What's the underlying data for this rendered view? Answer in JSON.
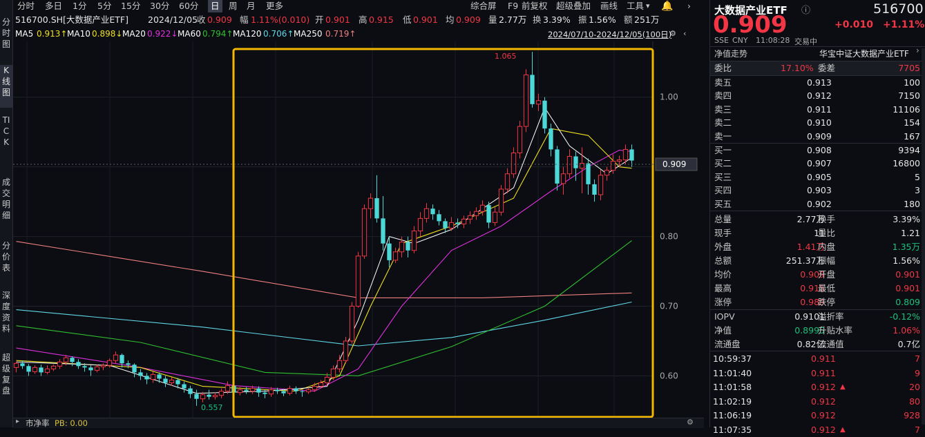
{
  "left_tabs": [
    {
      "label": "分时图"
    },
    {
      "label": "K线图"
    },
    {
      "label": "TICK"
    },
    {
      "label": "成交明细"
    },
    {
      "label": "分价表"
    },
    {
      "label": "深度资料"
    },
    {
      "label": "超级复盘"
    }
  ],
  "toolbar": {
    "periods": [
      "分时",
      "多日",
      "1分",
      "5分",
      "15分",
      "30分",
      "60分",
      "日",
      "周",
      "月",
      "更多"
    ],
    "active_period": "日",
    "right_items": [
      "综合屏",
      "F9",
      "前复权",
      "超级叠加",
      "画线",
      "工具"
    ]
  },
  "info_line": {
    "symbol": "516700.SH[大数据产业ETF]",
    "date": "2024/12/05",
    "close_label": "收",
    "close": "0.909",
    "amp_label": "幅",
    "amp": "1.11%(0.010)",
    "open_label": "开",
    "open": "0.901",
    "high_label": "高",
    "high": "0.915",
    "low_label": "低",
    "low": "0.901",
    "avg_label": "均",
    "avg": "0.909",
    "vol_label": "量",
    "vol": "2.77万",
    "turn_label": "换",
    "turn": "3.39%",
    "swing_label": "振",
    "swing": "1.56%",
    "amount_label": "额",
    "amount": "251万"
  },
  "ma_line": {
    "ma5_label": "MA5",
    "ma5": "0.913↑",
    "ma10_label": "MA10",
    "ma10": "0.898↓",
    "ma20_label": "MA20",
    "ma20": "0.922↓",
    "ma60_label": "MA60",
    "ma60": "0.794↑",
    "ma120_label": "MA120",
    "ma120": "0.706↑",
    "ma250_label": "MA250",
    "ma250": "0.719↑",
    "range": "2024/07/10-2024/12/05(100日)"
  },
  "colors": {
    "ma5": "#ffffff",
    "ma10": "#f0e020",
    "ma20": "#e030e0",
    "ma60": "#30c030",
    "ma120": "#60d8e8",
    "ma250": "#f08080",
    "up": "#f23645",
    "down": "#4dd8d8",
    "highlight": "#f5b800"
  },
  "chart_data": {
    "type": "candlestick",
    "y_ticks": [
      "1.00",
      "0.90",
      "0.80",
      "0.70",
      "0.60"
    ],
    "ylim": [
      0.54,
      1.08
    ],
    "price_tag": "0.909",
    "high_label": "1.065",
    "low_label": "0.557",
    "candles": [
      [
        0.612,
        0.618,
        0.605,
        0.62
      ],
      [
        0.618,
        0.614,
        0.61,
        0.622
      ],
      [
        0.614,
        0.606,
        0.6,
        0.617
      ],
      [
        0.606,
        0.612,
        0.603,
        0.615
      ],
      [
        0.612,
        0.605,
        0.6,
        0.616
      ],
      [
        0.605,
        0.61,
        0.602,
        0.615
      ],
      [
        0.61,
        0.614,
        0.607,
        0.616
      ],
      [
        0.614,
        0.62,
        0.61,
        0.624
      ],
      [
        0.62,
        0.626,
        0.615,
        0.63
      ],
      [
        0.626,
        0.62,
        0.614,
        0.628
      ],
      [
        0.62,
        0.614,
        0.61,
        0.624
      ],
      [
        0.614,
        0.612,
        0.606,
        0.618
      ],
      [
        0.612,
        0.608,
        0.6,
        0.615
      ],
      [
        0.608,
        0.613,
        0.605,
        0.616
      ],
      [
        0.613,
        0.615,
        0.608,
        0.618
      ],
      [
        0.615,
        0.622,
        0.612,
        0.625
      ],
      [
        0.622,
        0.63,
        0.618,
        0.635
      ],
      [
        0.63,
        0.618,
        0.612,
        0.632
      ],
      [
        0.618,
        0.616,
        0.611,
        0.622
      ],
      [
        0.616,
        0.605,
        0.598,
        0.618
      ],
      [
        0.605,
        0.6,
        0.594,
        0.61
      ],
      [
        0.6,
        0.595,
        0.588,
        0.604
      ],
      [
        0.595,
        0.602,
        0.59,
        0.606
      ],
      [
        0.602,
        0.596,
        0.59,
        0.605
      ],
      [
        0.596,
        0.59,
        0.584,
        0.6
      ],
      [
        0.59,
        0.594,
        0.586,
        0.598
      ],
      [
        0.594,
        0.588,
        0.582,
        0.597
      ],
      [
        0.588,
        0.582,
        0.576,
        0.592
      ],
      [
        0.582,
        0.574,
        0.568,
        0.586
      ],
      [
        0.574,
        0.567,
        0.557,
        0.58
      ],
      [
        0.567,
        0.573,
        0.562,
        0.577
      ],
      [
        0.573,
        0.57,
        0.566,
        0.58
      ],
      [
        0.57,
        0.572,
        0.566,
        0.576
      ],
      [
        0.572,
        0.578,
        0.568,
        0.582
      ],
      [
        0.578,
        0.586,
        0.574,
        0.592
      ],
      [
        0.586,
        0.576,
        0.57,
        0.59
      ],
      [
        0.576,
        0.58,
        0.572,
        0.584
      ],
      [
        0.58,
        0.578,
        0.574,
        0.584
      ],
      [
        0.578,
        0.582,
        0.574,
        0.586
      ],
      [
        0.582,
        0.576,
        0.57,
        0.585
      ],
      [
        0.576,
        0.574,
        0.568,
        0.58
      ],
      [
        0.574,
        0.58,
        0.57,
        0.584
      ],
      [
        0.58,
        0.578,
        0.574,
        0.583
      ],
      [
        0.578,
        0.575,
        0.571,
        0.581
      ],
      [
        0.575,
        0.582,
        0.572,
        0.586
      ],
      [
        0.582,
        0.578,
        0.574,
        0.585
      ],
      [
        0.578,
        0.577,
        0.57,
        0.58
      ],
      [
        0.577,
        0.58,
        0.574,
        0.583
      ],
      [
        0.58,
        0.585,
        0.577,
        0.59
      ],
      [
        0.585,
        0.59,
        0.582,
        0.594
      ],
      [
        0.59,
        0.598,
        0.586,
        0.604
      ],
      [
        0.598,
        0.61,
        0.594,
        0.615
      ],
      [
        0.61,
        0.622,
        0.605,
        0.63
      ],
      [
        0.622,
        0.65,
        0.618,
        0.656
      ],
      [
        0.65,
        0.7,
        0.646,
        0.706
      ],
      [
        0.7,
        0.772,
        0.698,
        0.778
      ],
      [
        0.772,
        0.84,
        0.768,
        0.846
      ],
      [
        0.84,
        0.855,
        0.826,
        0.862
      ],
      [
        0.855,
        0.826,
        0.82,
        0.888
      ],
      [
        0.826,
        0.79,
        0.78,
        0.858
      ],
      [
        0.79,
        0.766,
        0.756,
        0.8
      ],
      [
        0.766,
        0.778,
        0.762,
        0.784
      ],
      [
        0.778,
        0.792,
        0.77,
        0.8
      ],
      [
        0.792,
        0.78,
        0.77,
        0.8
      ],
      [
        0.78,
        0.808,
        0.776,
        0.815
      ],
      [
        0.808,
        0.826,
        0.8,
        0.835
      ],
      [
        0.826,
        0.84,
        0.82,
        0.848
      ],
      [
        0.84,
        0.832,
        0.824,
        0.846
      ],
      [
        0.832,
        0.822,
        0.816,
        0.838
      ],
      [
        0.822,
        0.812,
        0.805,
        0.826
      ],
      [
        0.812,
        0.82,
        0.808,
        0.828
      ],
      [
        0.82,
        0.818,
        0.812,
        0.826
      ],
      [
        0.818,
        0.825,
        0.812,
        0.83
      ],
      [
        0.825,
        0.83,
        0.818,
        0.836
      ],
      [
        0.83,
        0.836,
        0.824,
        0.842
      ],
      [
        0.836,
        0.845,
        0.83,
        0.852
      ],
      [
        0.845,
        0.82,
        0.812,
        0.85
      ],
      [
        0.82,
        0.835,
        0.815,
        0.842
      ],
      [
        0.835,
        0.868,
        0.83,
        0.874
      ],
      [
        0.868,
        0.89,
        0.862,
        0.898
      ],
      [
        0.89,
        0.92,
        0.884,
        0.928
      ],
      [
        0.92,
        0.958,
        0.912,
        0.966
      ],
      [
        0.958,
        1.032,
        0.95,
        1.04
      ],
      [
        1.032,
        0.99,
        0.985,
        1.065
      ],
      [
        0.99,
        0.995,
        0.98,
        1.005
      ],
      [
        0.995,
        0.955,
        0.948,
        1.0
      ],
      [
        0.955,
        0.925,
        0.915,
        0.962
      ],
      [
        0.925,
        0.876,
        0.866,
        0.93
      ],
      [
        0.876,
        0.89,
        0.86,
        0.9
      ],
      [
        0.89,
        0.915,
        0.884,
        0.925
      ],
      [
        0.915,
        0.898,
        0.88,
        0.922
      ],
      [
        0.898,
        0.905,
        0.862,
        0.928
      ],
      [
        0.905,
        0.875,
        0.86,
        0.912
      ],
      [
        0.875,
        0.86,
        0.85,
        0.882
      ],
      [
        0.86,
        0.888,
        0.852,
        0.896
      ],
      [
        0.888,
        0.895,
        0.88,
        0.9
      ],
      [
        0.895,
        0.908,
        0.89,
        0.918
      ],
      [
        0.908,
        0.91,
        0.9,
        0.916
      ],
      [
        0.91,
        0.925,
        0.904,
        0.932
      ],
      [
        0.925,
        0.909,
        0.9,
        0.932
      ]
    ],
    "ma_lines": {
      "ma5": [
        [
          0,
          0.62
        ],
        [
          15,
          0.615
        ],
        [
          29,
          0.575
        ],
        [
          40,
          0.578
        ],
        [
          50,
          0.585
        ],
        [
          55,
          0.68
        ],
        [
          60,
          0.8
        ],
        [
          64,
          0.79
        ],
        [
          70,
          0.81
        ],
        [
          80,
          0.87
        ],
        [
          85,
          0.985
        ],
        [
          89,
          0.93
        ],
        [
          95,
          0.89
        ],
        [
          99,
          0.913
        ]
      ],
      "ma10": [
        [
          0,
          0.622
        ],
        [
          20,
          0.612
        ],
        [
          30,
          0.585
        ],
        [
          45,
          0.578
        ],
        [
          52,
          0.6
        ],
        [
          57,
          0.7
        ],
        [
          62,
          0.79
        ],
        [
          70,
          0.815
        ],
        [
          80,
          0.855
        ],
        [
          86,
          0.955
        ],
        [
          92,
          0.945
        ],
        [
          97,
          0.9
        ],
        [
          99,
          0.898
        ]
      ],
      "ma20": [
        [
          0,
          0.64
        ],
        [
          20,
          0.612
        ],
        [
          35,
          0.586
        ],
        [
          48,
          0.578
        ],
        [
          55,
          0.61
        ],
        [
          62,
          0.7
        ],
        [
          70,
          0.78
        ],
        [
          78,
          0.815
        ],
        [
          86,
          0.865
        ],
        [
          92,
          0.9
        ],
        [
          97,
          0.924
        ],
        [
          99,
          0.922
        ]
      ],
      "ma60": [
        [
          0,
          0.672
        ],
        [
          20,
          0.648
        ],
        [
          40,
          0.605
        ],
        [
          55,
          0.6
        ],
        [
          70,
          0.642
        ],
        [
          85,
          0.7
        ],
        [
          99,
          0.794
        ]
      ],
      "ma120": [
        [
          0,
          0.695
        ],
        [
          30,
          0.67
        ],
        [
          55,
          0.643
        ],
        [
          70,
          0.655
        ],
        [
          85,
          0.68
        ],
        [
          99,
          0.706
        ]
      ],
      "ma250": [
        [
          0,
          0.793
        ],
        [
          30,
          0.75
        ],
        [
          55,
          0.712
        ],
        [
          75,
          0.712
        ],
        [
          99,
          0.719
        ]
      ]
    }
  },
  "bottom": {
    "left": "市净率",
    "pb": "PB: 0.00"
  },
  "quote": {
    "name": "大数据产业ETF",
    "code": "516700",
    "price": "0.909",
    "change": "+0.010",
    "pct": "+1.11%",
    "market": "SSE",
    "currency": "CNY",
    "time": "11:08:28",
    "status": "交易中",
    "nav_trend": "净值走势",
    "index": "华宝中证大数据产业ETF",
    "weibi_label": "委比",
    "weibi": "17.10%",
    "weicha_label": "委差",
    "weicha": "7705",
    "asks": [
      {
        "label": "卖五",
        "price": "0.913",
        "vol": "100"
      },
      {
        "label": "卖四",
        "price": "0.912",
        "vol": "7150"
      },
      {
        "label": "卖三",
        "price": "0.911",
        "vol": "11106"
      },
      {
        "label": "卖二",
        "price": "0.910",
        "vol": "154"
      },
      {
        "label": "卖一",
        "price": "0.909",
        "vol": "167"
      }
    ],
    "bids": [
      {
        "label": "买一",
        "price": "0.908",
        "vol": "9394"
      },
      {
        "label": "买二",
        "price": "0.907",
        "vol": "16800"
      },
      {
        "label": "买三",
        "price": "0.905",
        "vol": "5"
      },
      {
        "label": "买四",
        "price": "0.903",
        "vol": "3"
      },
      {
        "label": "买五",
        "price": "0.902",
        "vol": "180"
      }
    ],
    "stats": [
      {
        "l1": "总量",
        "v1": "2.77万",
        "c1": "wht",
        "l2": "换手",
        "v2": "3.39%",
        "c2": "wht"
      },
      {
        "l1": "现手",
        "v1": "11",
        "c1": "wht",
        "l2": "量比",
        "v2": "1.21",
        "c2": "wht"
      },
      {
        "l1": "外盘",
        "v1": "1.41万",
        "c1": "red",
        "l2": "内盘",
        "v2": "1.35万",
        "c2": "grn"
      },
      {
        "l1": "总额",
        "v1": "251.37万",
        "c1": "wht",
        "l2": "振幅",
        "v2": "1.56%",
        "c2": "wht"
      },
      {
        "l1": "均价",
        "v1": "0.909",
        "c1": "red",
        "l2": "开盘",
        "v2": "0.901",
        "c2": "red"
      },
      {
        "l1": "最高",
        "v1": "0.915",
        "c1": "red",
        "l2": "最低",
        "v2": "0.901",
        "c2": "red"
      },
      {
        "l1": "涨停",
        "v1": "0.989",
        "c1": "red",
        "l2": "跌停",
        "v2": "0.809",
        "c2": "grn"
      }
    ],
    "stats2": [
      {
        "l1": "IOPV",
        "v1": "0.9101",
        "c1": "wht",
        "l2": "溢折率",
        "v2": "-0.12%",
        "c2": "grn"
      },
      {
        "l1": "净值",
        "v1": "0.8995",
        "c1": "grn",
        "l2": "升贴水率",
        "v2": "1.06%",
        "c2": "red"
      },
      {
        "l1": "流通盘",
        "v1": "0.82亿",
        "c1": "wht",
        "l2": "流通值",
        "v2": "0.7亿",
        "c2": "wht"
      }
    ],
    "ticks": [
      {
        "time": "10:59:37",
        "price": "0.911",
        "arrow": "",
        "vol": "7"
      },
      {
        "time": "11:01:40",
        "price": "0.911",
        "arrow": "",
        "vol": "9"
      },
      {
        "time": "11:01:58",
        "price": "0.912",
        "arrow": "▲",
        "vol": "20"
      },
      {
        "time": "11:02:19",
        "price": "0.912",
        "arrow": "",
        "vol": "80"
      },
      {
        "time": "11:06:19",
        "price": "0.912",
        "arrow": "",
        "vol": "928"
      },
      {
        "time": "11:07:35",
        "price": "0.912",
        "arrow": "▲",
        "vol": "7"
      }
    ]
  }
}
